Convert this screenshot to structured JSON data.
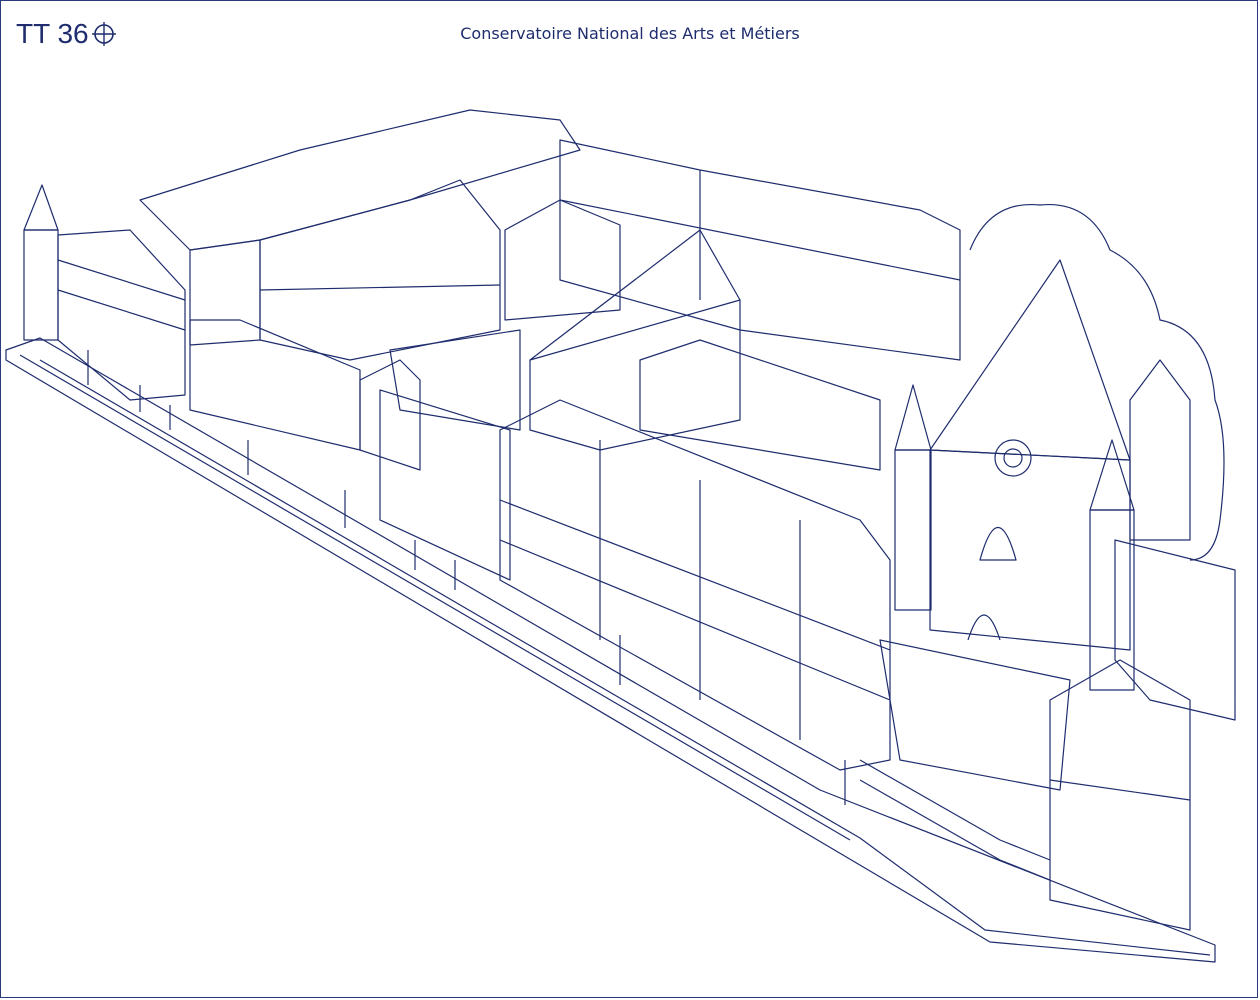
{
  "header": {
    "logo_text": "TT 36",
    "logo_icon": "crosshair-icon",
    "title": "Conservatoire National des Arts et Métiers"
  },
  "illustration": {
    "subject": "aerial line drawing",
    "ink_color": "#1f2d6e",
    "background_color": "#ffffff"
  }
}
